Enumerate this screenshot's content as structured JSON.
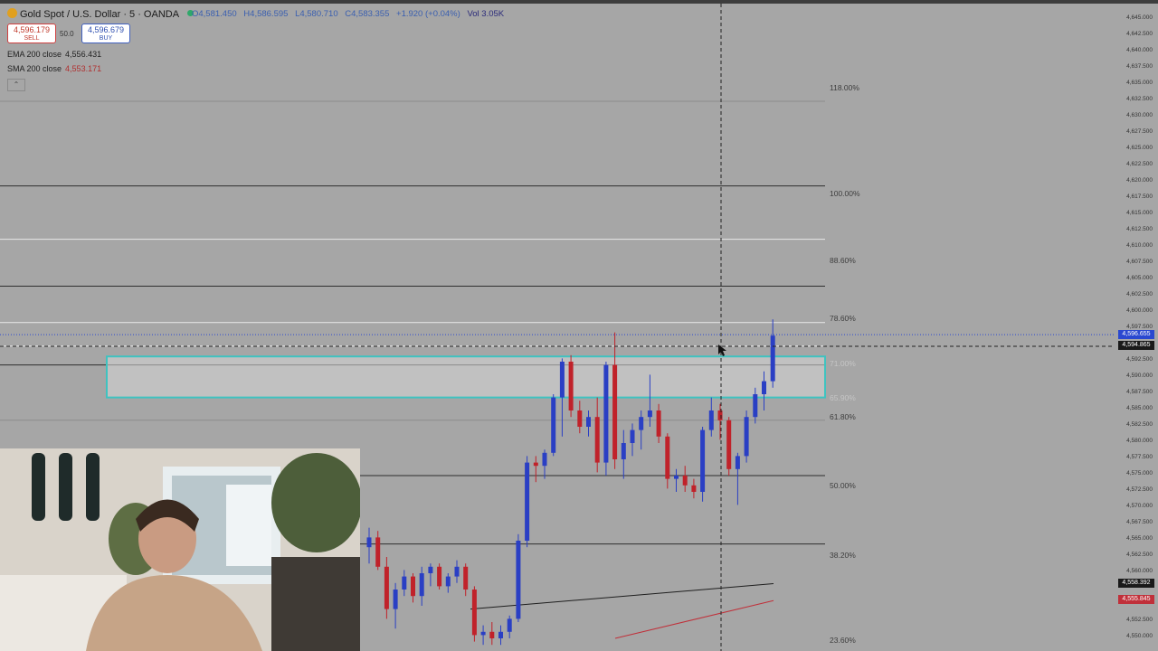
{
  "header": {
    "symbol": "Gold Spot / U.S. Dollar · 5 · OANDA",
    "open": "O4,581.450",
    "high": "H4,586.595",
    "low": "L4,580.710",
    "close": "C4,583.355",
    "change": "+1.920 (+0.04%)",
    "volume": "Vol 3.05K"
  },
  "trade": {
    "sell_price": "4,596.179",
    "sell_label": "SELL",
    "spread": "50.0",
    "buy_price": "4,596.679",
    "buy_label": "BUY"
  },
  "indicators": {
    "ema_label": "EMA 200 close",
    "ema_value": "4,556.431",
    "sma_label": "SMA 200 close",
    "sma_value": "4,553.171"
  },
  "fib_levels": [
    {
      "label": "118.00%"
    },
    {
      "label": "100.00%"
    },
    {
      "label": "88.60%"
    },
    {
      "label": "78.60%"
    },
    {
      "label": "71.00%"
    },
    {
      "label": "65.90%"
    },
    {
      "label": "61.80%"
    },
    {
      "label": "50.00%"
    },
    {
      "label": "38.20%"
    },
    {
      "label": "23.60%"
    }
  ],
  "price_axis": [
    "4,645.000",
    "4,642.500",
    "4,640.000",
    "4,637.500",
    "4,635.000",
    "4,632.500",
    "4,630.000",
    "4,627.500",
    "4,625.000",
    "4,622.500",
    "4,620.000",
    "4,617.500",
    "4,615.000",
    "4,612.500",
    "4,610.000",
    "4,607.500",
    "4,605.000",
    "4,602.500",
    "4,600.000",
    "4,597.500",
    "4,592.500",
    "4,590.000",
    "4,587.500",
    "4,585.000",
    "4,582.500",
    "4,580.000",
    "4,577.500",
    "4,575.000",
    "4,572.500",
    "4,570.000",
    "4,567.500",
    "4,565.000",
    "4,562.500",
    "4,560.000",
    "4,557.500",
    "4,552.500",
    "4,550.000"
  ],
  "price_labels": {
    "last_price": "4,596.655",
    "cursor_price": "4,594.865",
    "ema_tag": "4,558.392",
    "sma_tag": "4,555.845"
  },
  "colors": {
    "bull": "#2a3fc4",
    "bear": "#c0222a",
    "zone_border": "#3fc3c0",
    "ema": "#1e1e1e",
    "sma": "#c0303a"
  },
  "icons": {
    "symbol_icon": "gold-coin-icon",
    "collapse_icon": "chevron-up-icon"
  },
  "chart_data": {
    "type": "candlestick",
    "candles": [
      {
        "o": 4564.0,
        "h": 4567.0,
        "l": 4561.5,
        "c": 4565.5
      },
      {
        "o": 4565.5,
        "h": 4566.5,
        "l": 4560.5,
        "c": 4561.0
      },
      {
        "o": 4561.0,
        "h": 4562.5,
        "l": 4553.0,
        "c": 4554.5
      },
      {
        "o": 4554.5,
        "h": 4558.5,
        "l": 4551.5,
        "c": 4557.5
      },
      {
        "o": 4557.5,
        "h": 4560.5,
        "l": 4556.5,
        "c": 4559.5
      },
      {
        "o": 4559.5,
        "h": 4560.0,
        "l": 4555.5,
        "c": 4556.5
      },
      {
        "o": 4556.5,
        "h": 4561.0,
        "l": 4555.0,
        "c": 4560.0
      },
      {
        "o": 4560.0,
        "h": 4561.5,
        "l": 4558.0,
        "c": 4561.0
      },
      {
        "o": 4561.0,
        "h": 4561.5,
        "l": 4557.5,
        "c": 4558.0
      },
      {
        "o": 4558.0,
        "h": 4560.0,
        "l": 4557.0,
        "c": 4559.5
      },
      {
        "o": 4559.5,
        "h": 4562.0,
        "l": 4558.5,
        "c": 4561.0
      },
      {
        "o": 4561.0,
        "h": 4561.5,
        "l": 4556.5,
        "c": 4557.5
      },
      {
        "o": 4557.5,
        "h": 4558.0,
        "l": 4549.5,
        "c": 4550.5
      },
      {
        "o": 4550.5,
        "h": 4552.0,
        "l": 4549.0,
        "c": 4551.0
      },
      {
        "o": 4551.0,
        "h": 4552.5,
        "l": 4549.0,
        "c": 4550.0
      },
      {
        "o": 4550.0,
        "h": 4552.0,
        "l": 4549.0,
        "c": 4551.0
      },
      {
        "o": 4551.0,
        "h": 4553.5,
        "l": 4550.0,
        "c": 4553.0
      },
      {
        "o": 4553.0,
        "h": 4566.0,
        "l": 4552.5,
        "c": 4565.0
      },
      {
        "o": 4565.0,
        "h": 4578.0,
        "l": 4564.0,
        "c": 4577.0
      },
      {
        "o": 4577.0,
        "h": 4578.0,
        "l": 4574.0,
        "c": 4576.5
      },
      {
        "o": 4576.5,
        "h": 4579.0,
        "l": 4574.5,
        "c": 4578.5
      },
      {
        "o": 4578.5,
        "h": 4587.5,
        "l": 4578.0,
        "c": 4587.0
      },
      {
        "o": 4587.0,
        "h": 4593.0,
        "l": 4581.0,
        "c": 4592.5
      },
      {
        "o": 4592.5,
        "h": 4593.5,
        "l": 4584.0,
        "c": 4585.0
      },
      {
        "o": 4585.0,
        "h": 4586.5,
        "l": 4581.5,
        "c": 4582.5
      },
      {
        "o": 4582.5,
        "h": 4585.0,
        "l": 4581.0,
        "c": 4584.0
      },
      {
        "o": 4584.0,
        "h": 4587.0,
        "l": 4575.5,
        "c": 4577.0
      },
      {
        "o": 4577.0,
        "h": 4592.5,
        "l": 4575.0,
        "c": 4592.0
      },
      {
        "o": 4592.0,
        "h": 4597.0,
        "l": 4576.0,
        "c": 4577.5
      },
      {
        "o": 4577.5,
        "h": 4582.0,
        "l": 4574.5,
        "c": 4580.0
      },
      {
        "o": 4580.0,
        "h": 4583.0,
        "l": 4578.0,
        "c": 4582.0
      },
      {
        "o": 4582.0,
        "h": 4585.0,
        "l": 4579.0,
        "c": 4584.0
      },
      {
        "o": 4584.0,
        "h": 4590.5,
        "l": 4582.5,
        "c": 4585.0
      },
      {
        "o": 4585.0,
        "h": 4586.0,
        "l": 4580.0,
        "c": 4581.0
      },
      {
        "o": 4581.0,
        "h": 4581.5,
        "l": 4573.0,
        "c": 4574.5
      },
      {
        "o": 4574.5,
        "h": 4576.0,
        "l": 4572.5,
        "c": 4575.0
      },
      {
        "o": 4575.0,
        "h": 4576.5,
        "l": 4572.5,
        "c": 4573.5
      },
      {
        "o": 4573.5,
        "h": 4574.5,
        "l": 4571.5,
        "c": 4572.5
      },
      {
        "o": 4572.5,
        "h": 4582.5,
        "l": 4571.0,
        "c": 4582.0
      },
      {
        "o": 4582.0,
        "h": 4587.0,
        "l": 4581.0,
        "c": 4585.0
      },
      {
        "o": 4585.0,
        "h": 4586.0,
        "l": 4580.5,
        "c": 4583.5
      },
      {
        "o": 4583.5,
        "h": 4584.0,
        "l": 4575.0,
        "c": 4576.0
      },
      {
        "o": 4576.0,
        "h": 4578.5,
        "l": 4570.5,
        "c": 4578.0
      },
      {
        "o": 4578.0,
        "h": 4585.0,
        "l": 4577.0,
        "c": 4584.0
      },
      {
        "o": 4584.0,
        "h": 4588.5,
        "l": 4583.0,
        "c": 4587.5
      },
      {
        "o": 4587.5,
        "h": 4591.0,
        "l": 4585.0,
        "c": 4589.5
      },
      {
        "o": 4589.5,
        "h": 4599.0,
        "l": 4588.5,
        "c": 4596.5
      }
    ],
    "fib_prices": [
      4632.5,
      4619.5,
      4611.3,
      4604.1,
      4598.5,
      4594.9,
      4592.0,
      4583.5,
      4575.0,
      4564.5
    ],
    "zone": {
      "top": 4593.3,
      "bottom": 4587.0
    },
    "ema_line": [
      [
        4554.5,
        4556.0
      ],
      [
        4556.5,
        4558.4
      ]
    ],
    "sma_line": [
      [
        4550.0,
        4551.6
      ],
      [
        4554.0,
        4555.8
      ]
    ],
    "last_price": 4596.655,
    "cursor_price": 4594.865
  }
}
